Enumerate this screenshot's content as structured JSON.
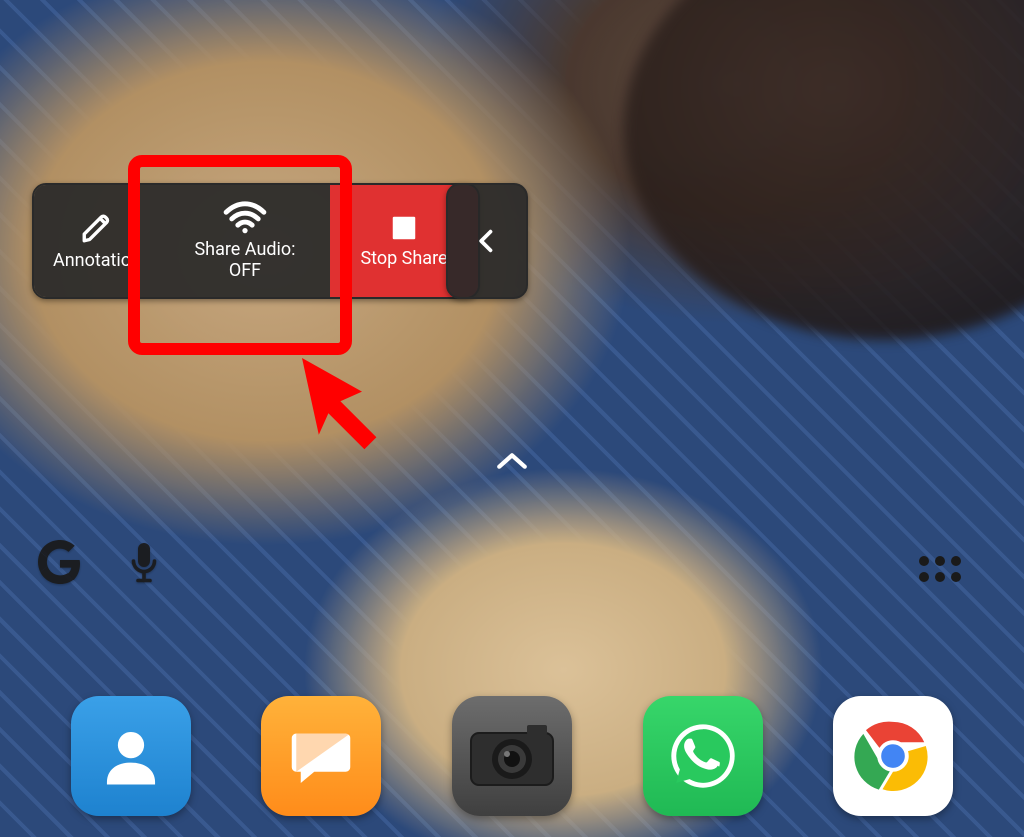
{
  "share_toolbar": {
    "annotation": {
      "label": "Annotation",
      "icon": "pencil-icon"
    },
    "share_audio": {
      "label": "Share Audio:\nOFF",
      "icon": "wifi-icon"
    },
    "stop_share": {
      "label": "Stop Share",
      "icon": "stop-icon"
    },
    "collapse": {
      "icon": "chevron-left-icon"
    }
  },
  "annotation_overlay": {
    "highlight_target": "share-audio-button",
    "highlight_color": "#ff0000",
    "arrow_color": "#ff0000"
  },
  "home_indicators": {
    "swipe_up_icon": "chevron-up-icon",
    "app_drawer_icon": "app-drawer-dots-icon"
  },
  "search_widget": {
    "google_icon": "google-g-icon",
    "mic_icon": "microphone-icon"
  },
  "dock": [
    {
      "name": "Contacts",
      "icon": "contacts-icon",
      "color": "#2a8fda"
    },
    {
      "name": "Messages",
      "icon": "messages-icon",
      "color": "#ff9a2b"
    },
    {
      "name": "Camera",
      "icon": "camera-icon",
      "color": "#555555"
    },
    {
      "name": "WhatsApp",
      "icon": "whatsapp-icon",
      "color": "#29c95e"
    },
    {
      "name": "Chrome",
      "icon": "chrome-icon",
      "color": "#ffffff"
    }
  ]
}
